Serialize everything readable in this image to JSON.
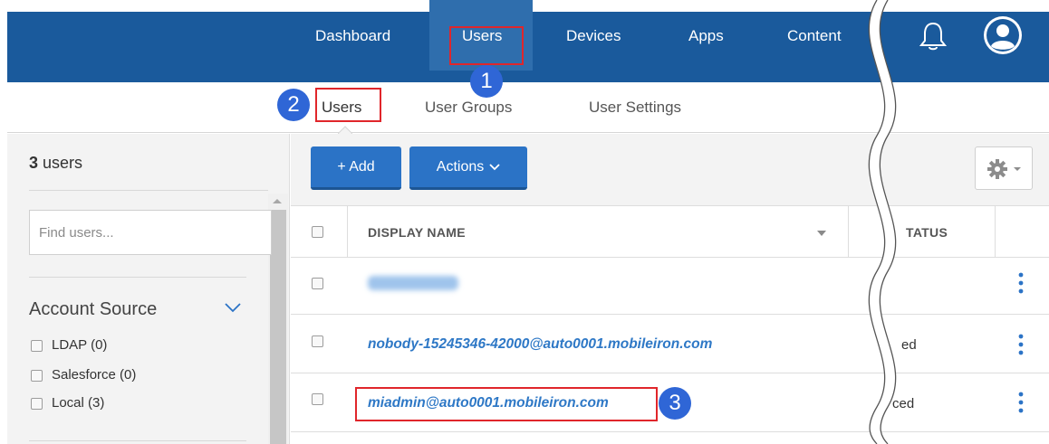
{
  "topnav": {
    "items": [
      "Dashboard",
      "Users",
      "Devices",
      "Apps",
      "Content"
    ],
    "active": "Users",
    "icons": [
      "bell-icon",
      "user-avatar-icon"
    ],
    "color": "#1a5a9c"
  },
  "subnav": {
    "items": [
      "Users",
      "User Groups",
      "User Settings"
    ],
    "active": "Users"
  },
  "sidebar": {
    "count_number": "3",
    "count_suffix": " users",
    "search_placeholder": "Find users...",
    "account_source": {
      "title": "Account Source",
      "options": [
        "LDAP (0)",
        "Salesforce (0)",
        "Local (3)"
      ]
    }
  },
  "toolbar": {
    "add_label": "+ Add",
    "actions_label": "Actions",
    "accent": "#2b73c6"
  },
  "table": {
    "columns": [
      "DISPLAY NAME",
      "TATUS"
    ],
    "rows": [
      {
        "name": "",
        "status": ""
      },
      {
        "name": "nobody-15245346-42000@auto0001.mobileiron.com",
        "status": "ed"
      },
      {
        "name": "miadmin@auto0001.mobileiron.com",
        "status": "ced"
      }
    ]
  },
  "callouts": [
    "1",
    "2",
    "3"
  ]
}
